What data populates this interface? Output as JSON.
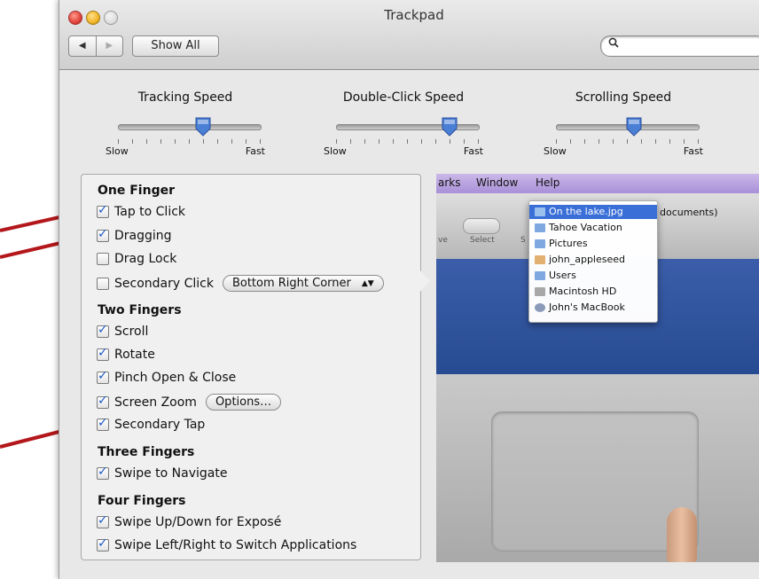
{
  "window": {
    "title": "Trackpad"
  },
  "toolbar": {
    "back_label": "◀",
    "forward_label": "▶",
    "show_all_label": "Show All",
    "search_icon": "search-icon",
    "search_value": ""
  },
  "sliders": [
    {
      "label": "Tracking Speed",
      "min_label": "Slow",
      "max_label": "Fast",
      "value": 0.6
    },
    {
      "label": "Double-Click Speed",
      "min_label": "Slow",
      "max_label": "Fast",
      "value": 0.8
    },
    {
      "label": "Scrolling Speed",
      "min_label": "Slow",
      "max_label": "Fast",
      "value": 0.55
    }
  ],
  "sections": {
    "one_finger": {
      "title": "One Finger",
      "options": [
        {
          "label": "Tap to Click",
          "checked": true
        },
        {
          "label": "Dragging",
          "checked": true
        },
        {
          "label": "Drag Lock",
          "checked": false
        },
        {
          "label": "Secondary Click",
          "checked": false,
          "popup": "Bottom Right Corner"
        }
      ]
    },
    "two_fingers": {
      "title": "Two Fingers",
      "options": [
        {
          "label": "Scroll",
          "checked": true
        },
        {
          "label": "Rotate",
          "checked": true
        },
        {
          "label": "Pinch Open & Close",
          "checked": true
        },
        {
          "label": "Screen Zoom",
          "checked": true,
          "button": "Options…"
        },
        {
          "label": "Secondary Tap",
          "checked": true
        }
      ]
    },
    "three_fingers": {
      "title": "Three Fingers",
      "options": [
        {
          "label": "Swipe to Navigate",
          "checked": true
        }
      ]
    },
    "four_fingers": {
      "title": "Four Fingers",
      "options": [
        {
          "label": "Swipe Up/Down for Exposé",
          "checked": true
        },
        {
          "label": "Swipe Left/Right to Switch Applications",
          "checked": true
        }
      ]
    }
  },
  "demo": {
    "menubar": [
      "arks",
      "Window",
      "Help"
    ],
    "toolbar_labels": [
      "Select",
      "ve",
      "S"
    ],
    "docs_text": "documents)",
    "menu_items": [
      {
        "label": "On the lake.jpg",
        "selected": true
      },
      {
        "label": "Tahoe Vacation"
      },
      {
        "label": "Pictures"
      },
      {
        "label": "john_appleseed"
      },
      {
        "label": "Users"
      },
      {
        "label": "Macintosh HD"
      },
      {
        "label": "John's MacBook"
      }
    ]
  },
  "colors": {
    "checkbox_check": "#1f5cc8",
    "annotation_arrow": "#b3171b",
    "thumb": "#4a7fd6"
  }
}
